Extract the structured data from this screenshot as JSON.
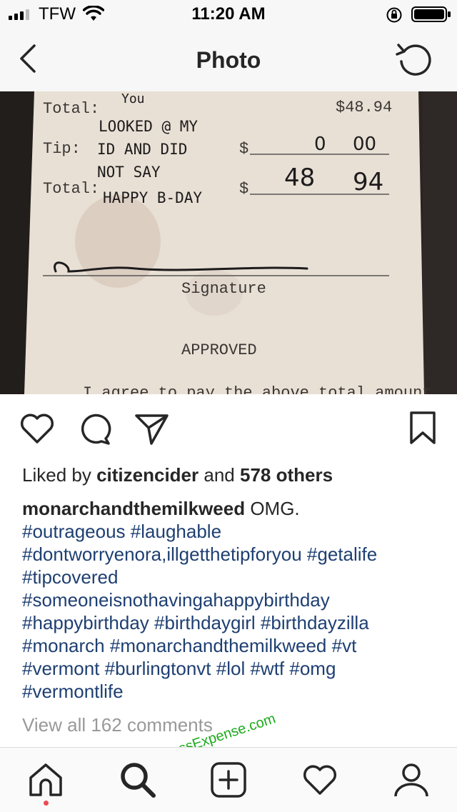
{
  "status_bar": {
    "carrier": "TFW",
    "time": "11:20 AM"
  },
  "nav": {
    "title": "Photo"
  },
  "receipt": {
    "line_top_total_label": "Total:",
    "line_top_total_value": "$48.94",
    "tip_label": "Tip:",
    "total_label": "Total:",
    "currency": "$",
    "tip_dollars": "0",
    "tip_cents": "00",
    "total_dollars": "48",
    "total_cents": "94",
    "handwritten_note": [
      "You",
      "LOOKED @ MY",
      "ID AND DID",
      "NOT SAY",
      "HAPPY B-DAY"
    ],
    "signature_label": "Signature",
    "approved_label": "APPROVED",
    "agree_text": "I agree to pay the above total amount"
  },
  "post": {
    "likes_prefix": "Liked by",
    "liked_by_user": "citizencider",
    "likes_and": "and",
    "likes_others": "578 others",
    "author": "monarchandthemilkweed",
    "caption_text": "OMG.",
    "caption_lines": [
      [
        "#outrageous",
        "#laughable"
      ],
      [
        "#dontworryenora,illgetthetipforyou",
        "#getalife"
      ],
      [
        "#tipcovered"
      ],
      [
        "#someoneisnothavingahappybirthday"
      ],
      [
        "#happybirthday",
        "#birthdaygirl",
        "#birthdayzilla"
      ],
      [
        "#monarch",
        "#monarchandthemilkweed",
        "#vt"
      ],
      [
        "#vermont",
        "#burlingtonvt",
        "#lol",
        "#wtf",
        "#omg"
      ],
      [
        "#vermontlife"
      ]
    ],
    "view_comments": "View all 162 comments"
  },
  "watermark": "ExpressExpense.com",
  "colors": {
    "hashtag": "#1e3f72",
    "muted": "#999999",
    "notification_dot": "#ed4956",
    "watermark": "#1aaa1a"
  },
  "icons": {
    "status": [
      "signal-icon",
      "wifi-icon",
      "rotation-lock-icon",
      "battery-icon"
    ],
    "nav": [
      "back-chevron-icon",
      "rotate-icon"
    ],
    "actions": [
      "heart-icon",
      "comment-icon",
      "share-icon",
      "bookmark-icon"
    ],
    "tabs": [
      "home-icon",
      "search-icon",
      "new-post-icon",
      "activity-heart-icon",
      "profile-icon"
    ]
  }
}
